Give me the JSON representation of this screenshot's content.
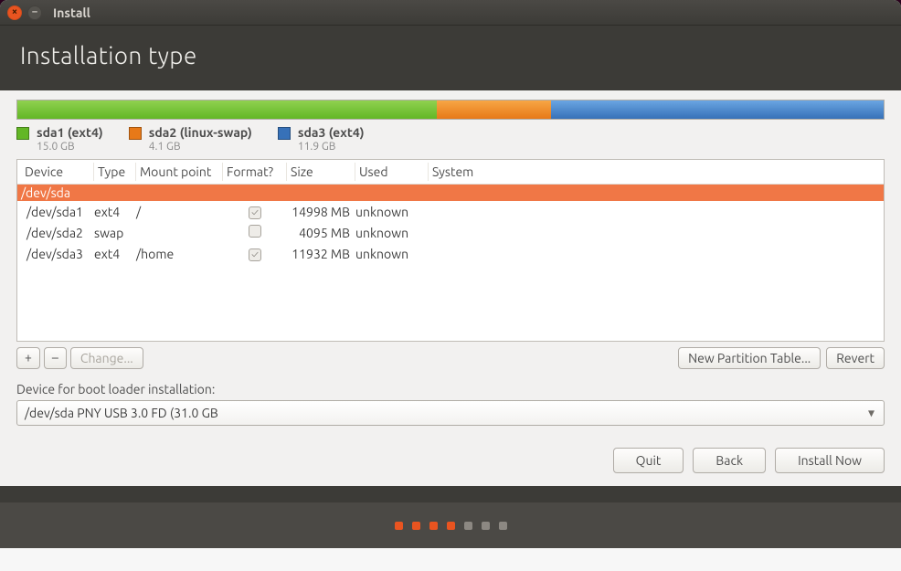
{
  "window": {
    "title": "Install"
  },
  "header": {
    "title": "Installation type"
  },
  "usage": {
    "segments": [
      {
        "name": "sda1 (ext4)",
        "size": "15.0 GB",
        "color": "green",
        "pct": 48.4
      },
      {
        "name": "sda2 (linux-swap)",
        "size": "4.1 GB",
        "color": "orange",
        "pct": 13.2
      },
      {
        "name": "sda3 (ext4)",
        "size": "11.9 GB",
        "color": "blue",
        "pct": 38.4
      }
    ]
  },
  "partition_table": {
    "columns": [
      "Device",
      "Type",
      "Mount point",
      "Format?",
      "Size",
      "Used",
      "System"
    ],
    "group": "/dev/sda",
    "rows": [
      {
        "device": "/dev/sda1",
        "type": "ext4",
        "mount": "/",
        "format": true,
        "size": "14998 MB",
        "used": "unknown",
        "system": ""
      },
      {
        "device": "/dev/sda2",
        "type": "swap",
        "mount": "",
        "format": false,
        "size": "4095 MB",
        "used": "unknown",
        "system": ""
      },
      {
        "device": "/dev/sda3",
        "type": "ext4",
        "mount": "/home",
        "format": true,
        "size": "11932 MB",
        "used": "unknown",
        "system": ""
      }
    ]
  },
  "toolbar": {
    "add": "+",
    "remove": "–",
    "change": "Change...",
    "new_table": "New Partition Table...",
    "revert": "Revert"
  },
  "bootloader": {
    "label": "Device for boot loader installation:",
    "value": "/dev/sda   PNY USB 3.0 FD (31.0 GB"
  },
  "nav": {
    "quit": "Quit",
    "back": "Back",
    "install": "Install Now"
  },
  "pager": {
    "total": 7,
    "active": 4
  }
}
